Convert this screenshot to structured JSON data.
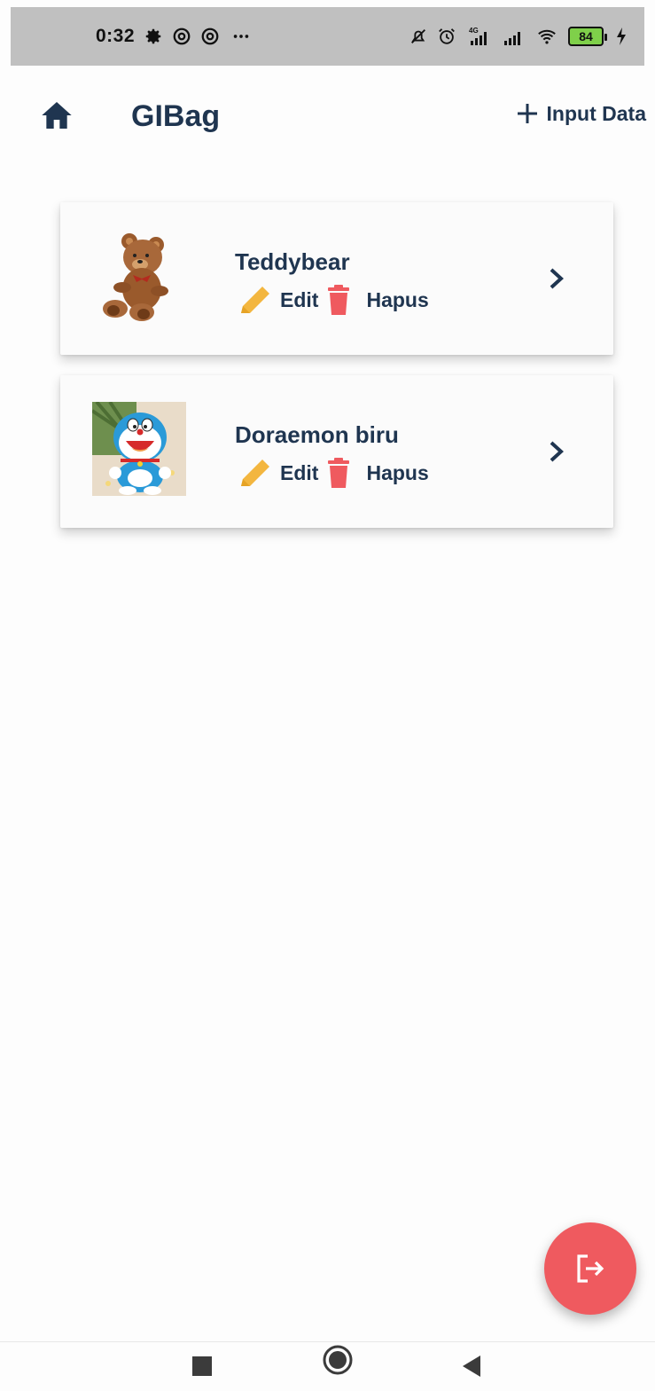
{
  "status_bar": {
    "time": "0:32",
    "left_icons": [
      "gear-icon",
      "at-icon",
      "at-icon",
      "more-icon"
    ],
    "right_icons": [
      "bell-off-icon",
      "alarm-icon",
      "signal-4g-icon",
      "signal-icon",
      "wifi-icon"
    ],
    "network_label": "4G",
    "battery": "84"
  },
  "app_bar": {
    "title": "GIBag",
    "home_icon": "home-icon",
    "input_button_label": "Input Data",
    "input_button_icon": "plus-icon"
  },
  "items": [
    {
      "name": "Teddybear",
      "image": "teddy-bear-photo",
      "edit_label": "Edit",
      "delete_label": "Hapus"
    },
    {
      "name": "Doraemon biru",
      "image": "doraemon-plush-photo",
      "edit_label": "Edit",
      "delete_label": "Hapus"
    }
  ],
  "fab": {
    "icon": "logout-icon"
  },
  "nav_bar": {
    "buttons": [
      "recents-square-icon",
      "home-circle-icon",
      "back-triangle-icon"
    ]
  },
  "colors": {
    "primary_text": "#1f3550",
    "edit_icon": "#f3b63f",
    "delete_icon": "#ef5a5f",
    "fab": "#ef5a5f",
    "status_bar": "#c0c0c0",
    "battery": "#7fd04a"
  }
}
